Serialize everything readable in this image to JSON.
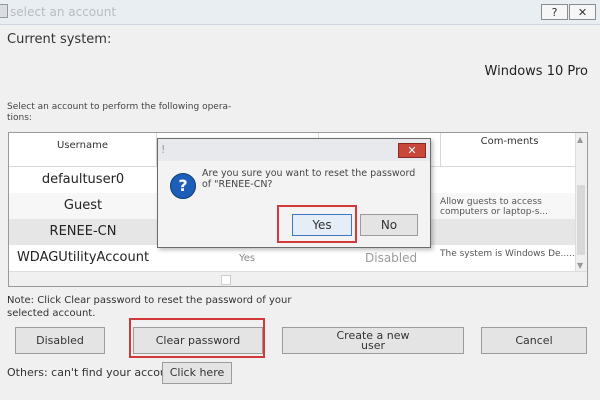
{
  "window": {
    "title": "select an account",
    "help_label": "?",
    "close_label": "✕"
  },
  "current_system": {
    "label": "Current system:",
    "value": "Windows 10 Pro"
  },
  "instruction": "Select an account to perform the following opera-tions:",
  "table": {
    "headers": {
      "username": "Username",
      "comments": "Com-ments"
    },
    "rows": [
      {
        "username": "defaultuser0",
        "enabled": "",
        "password": "",
        "comments": ""
      },
      {
        "username": "Guest",
        "enabled": "",
        "password": "",
        "comments": "Allow guests to access computers or laptop-s..."
      },
      {
        "username": "RENEE-CN",
        "enabled": "",
        "password": "",
        "comments": ""
      },
      {
        "username": "WDAGUtilityAccount",
        "enabled": "Yes",
        "password": "Disabled",
        "comments": "The system is Windows De...v..."
      }
    ]
  },
  "note": "Note: Click Clear password to reset the password of your selected account.",
  "buttons": {
    "disabled": "Disabled",
    "clear_password": "Clear password",
    "create_user": "Create a new user",
    "cancel": "Cancel",
    "click_here": "Click here"
  },
  "others_text": "Others: can't find your account?",
  "dialog": {
    "title_icon": "!",
    "close_label": "✕",
    "icon": "?",
    "message": "Are you sure you want to reset the password of \"RENEE-CN?",
    "yes": "Yes",
    "no": "No"
  },
  "colors": {
    "highlight": "#d23a3a",
    "question_icon": "#1d5fb8",
    "dialog_close": "#c9463a"
  },
  "icons": {
    "question": "question-icon",
    "close": "close-icon"
  }
}
